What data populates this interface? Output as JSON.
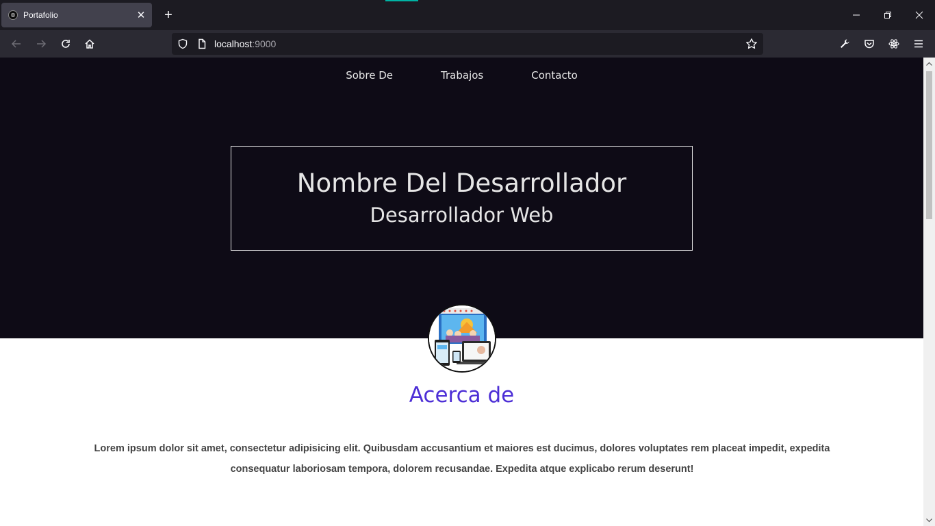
{
  "browser": {
    "tab_title": "Portafolio",
    "url_host": "localhost",
    "url_port": ":9000",
    "colors": {
      "accent": "#00b3a4",
      "chrome_dark": "#1c1b22",
      "toolbar": "#2b2a33"
    }
  },
  "site": {
    "nav": [
      {
        "label": "Sobre De"
      },
      {
        "label": "Trabajos"
      },
      {
        "label": "Contacto"
      }
    ],
    "hero": {
      "name": "Nombre Del Desarrollador",
      "role": "Desarrollador Web"
    },
    "about": {
      "title": "Acerca de",
      "text": "Lorem ipsum dolor sit amet, consectetur adipisicing elit. Quibusdam accusantium et maiores est ducimus, dolores voluptates rem placeat impedit, expedita consequatur laboriosam tempora, dolorem recusandae. Expedita atque explicabo rerum deserunt!"
    },
    "colors": {
      "hero_bg": "#0e0b16",
      "about_title": "#4d2fd6"
    }
  }
}
